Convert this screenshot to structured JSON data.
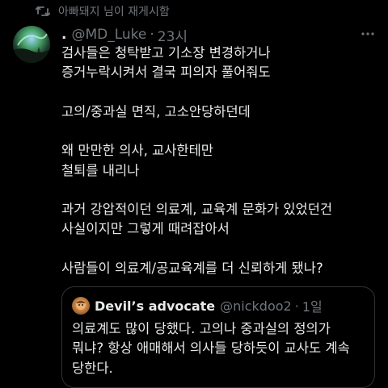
{
  "retweet": {
    "icon": "retweet-icon",
    "text": "아빠돼지 님이 재게시함"
  },
  "tweet": {
    "avatar_icon": "aurora-avatar",
    "display_name": ".",
    "handle": "@MD_Luke",
    "separator": "·",
    "time": "23시",
    "more_icon": "more-horizontal-icon",
    "paragraphs": [
      "검사들은 청탁받고 기소장 변경하거나\n증거누락시켜서 결국 피의자 풀어줘도",
      "고의/중과실 면직, 고소안당하던데",
      "왜 만만한 의사, 교사한테만\n철퇴를 내리나",
      "과거 강압적이던 의료계, 교육계 문화가 있었던건\n사실이지만 그렇게 때려잡아서",
      "사람들이 의료계/공교육계를 더 신뢰하게 됐나?"
    ]
  },
  "quote": {
    "avatar_icon": "cartoon-avatar",
    "display_name": "Devil’s advocate",
    "handle": "@nickdoo2",
    "separator": "·",
    "time": "1일",
    "text": "의료계도 많이 당했다. 고의나 중과실의 정의가\n뭐냐? 항상 애매해서 의사들 당하듯이 교사도 계속\n당한다."
  },
  "colors": {
    "background": "#000000",
    "text": "#e7e9ea",
    "secondary": "#71767b",
    "border": "#2f3336"
  }
}
